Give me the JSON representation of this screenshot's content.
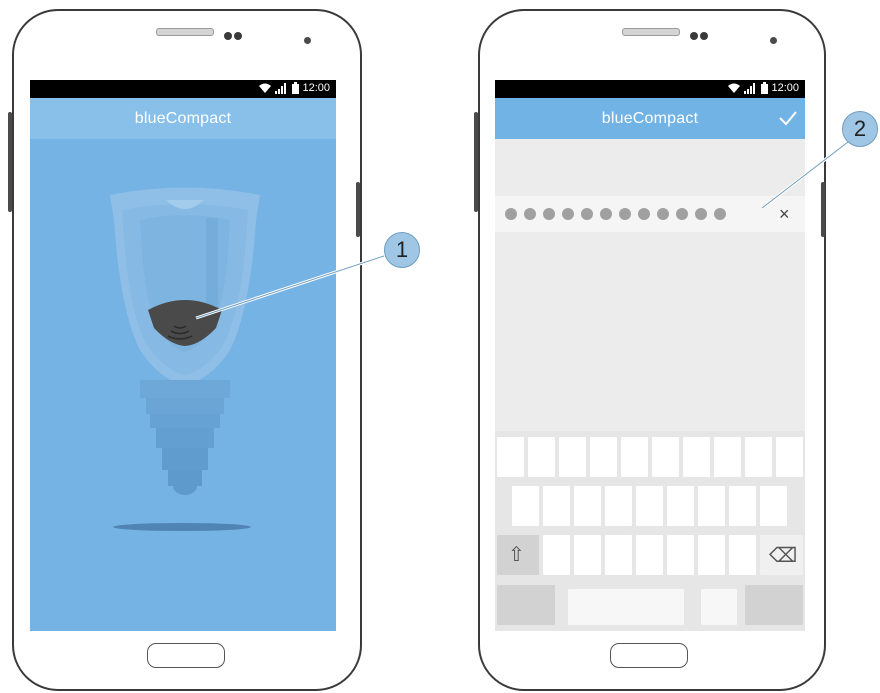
{
  "left_phone": {
    "status_time": "12:00",
    "title": "blueCompact",
    "callout": "1"
  },
  "right_phone": {
    "status_time": "12:00",
    "title": "blueCompact",
    "confirm_icon": "check-icon",
    "callout": "2",
    "pin_mask_count": 12,
    "clear_glyph": "×",
    "keyboard": {
      "shift_glyph": "⇧",
      "backspace_glyph": "⌫"
    }
  },
  "colors": {
    "screen_blue": "#76b3e5",
    "appbar_blue": "#88c0ea",
    "header_blue": "#72b3e6",
    "keyboard_bg": "#e6e6e6",
    "callout_blue": "#9fc6e4"
  }
}
